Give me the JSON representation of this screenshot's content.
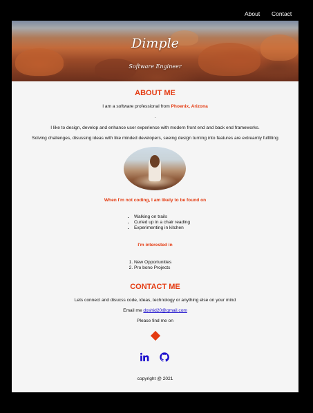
{
  "nav": {
    "about": "About",
    "contact": "Contact"
  },
  "hero": {
    "title": "Dimple",
    "subtitle": "Software Engineer"
  },
  "about": {
    "heading": "ABOUT ME",
    "intro_prefix": "I am a software professional from ",
    "location": "Phoenix, Arizona",
    "separator": ".",
    "line2": "I like to design, develop and enhance user experience with modern front end and back end frameworks.",
    "line3": "Solving challenges, disussing ideas with like minded developers, seeing design turning into features are extreamly fulfilling"
  },
  "hobbies": {
    "heading": "When I'm not coding, I am likely to be found on",
    "items": [
      "Walking on trails",
      "Curled up in a chair reading",
      "Experimenting in kitchen"
    ]
  },
  "interests": {
    "heading": "I'm interested in",
    "items": [
      "New Opportunities",
      "Pro bono Projects"
    ]
  },
  "contact": {
    "heading": "CONTACT ME",
    "lets": "Lets connect and disucss code, ideas, technology or anything else on your mind",
    "email_prefix": "Email me ",
    "email": "doshid20@gmail.com",
    "find": "Please find me on"
  },
  "footer": {
    "copyright": "copyright @ 2021"
  },
  "colors": {
    "accent": "#e43a10",
    "link": "#1a0dcc",
    "social": "#1a0dcc"
  },
  "icons": [
    "diamond-icon",
    "linkedin-icon",
    "github-icon"
  ]
}
